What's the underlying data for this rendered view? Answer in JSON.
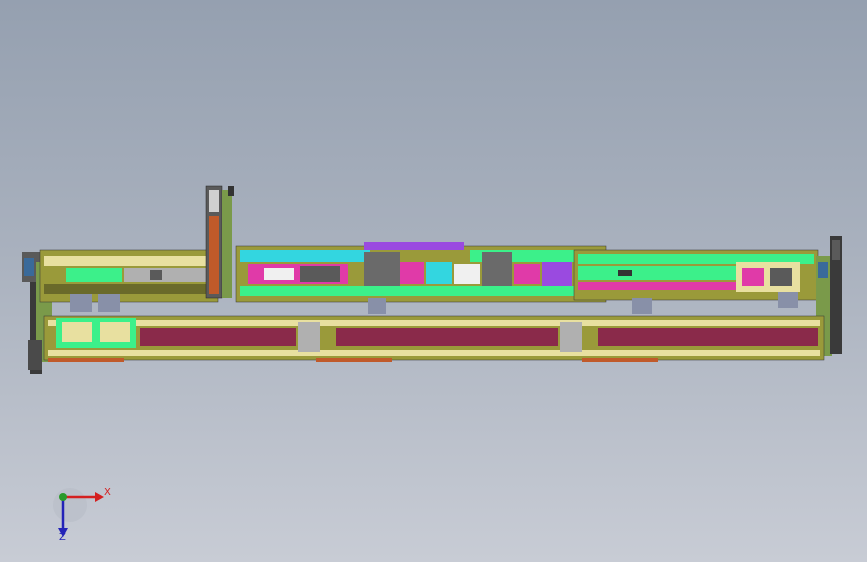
{
  "viewport": {
    "background_top": "#95a0b0",
    "background_bottom": "#c8ccd5"
  },
  "triad": {
    "x_label": "X",
    "z_label": "Z",
    "x_color": "#d42020",
    "y_color": "#2a9a2a",
    "z_color": "#2323b8"
  },
  "model": {
    "description_colors": {
      "frame_olive": "#9a9a3a",
      "rail_green": "#3cf08a",
      "belt_maroon": "#8a2a4a",
      "module_magenta": "#e03aa8",
      "module_cyan": "#33d6e0",
      "module_purple": "#9a4ae0",
      "motor_gray": "#8890a8",
      "chain_dark": "#3a3a3a",
      "panel_cream": "#e8e0a0"
    }
  }
}
